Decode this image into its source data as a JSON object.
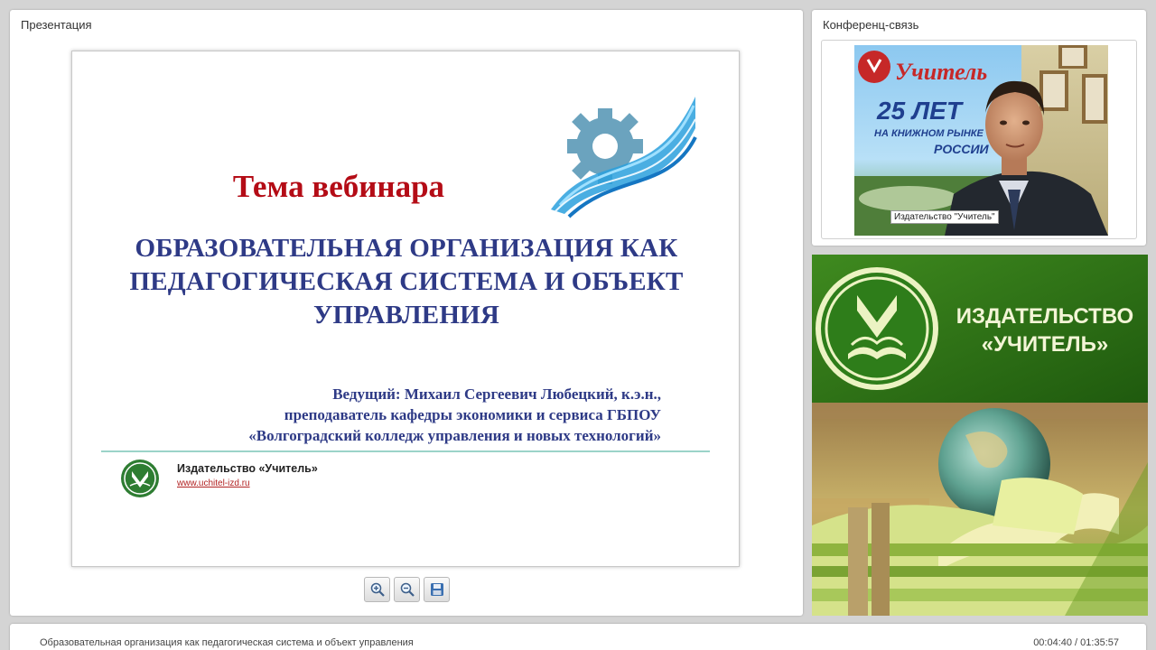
{
  "presentation_panel": {
    "title": "Презентация"
  },
  "slide": {
    "heading": "Тема вебинара",
    "subtitle_lines": [
      "ОБРАЗОВАТЕЛЬНАЯ ОРГАНИЗАЦИЯ КАК",
      "ПЕДАГОГИЧЕСКАЯ СИСТЕМА И ОБЪЕКТ",
      "УПРАВЛЕНИЯ"
    ],
    "presenter_lines": [
      "Ведущий: Михаил Сергеевич Любецкий, к.э.н.,",
      "преподаватель кафедры экономики и сервиса ГБПОУ",
      "«Волгоградский колледж управления и новых технологий»"
    ],
    "publisher": "Издательство «Учитель»",
    "url": "www.uchitel-izd.ru"
  },
  "toolbar": {
    "zoom_in_icon": "zoom-in-icon",
    "zoom_out_icon": "zoom-out-icon",
    "save_icon": "save-icon"
  },
  "conference_panel": {
    "title": "Конференц-связь",
    "caption": "Издательство \"Учитель\"",
    "backdrop": {
      "brand": "Учитель",
      "years": "25 ЛЕТ",
      "line1": "НА КНИЖНОМ РЫНКЕ",
      "line2": "РОССИИ"
    }
  },
  "banner": {
    "line1": "ИЗДАТЕЛЬСТВО",
    "line2": "«УЧИТЕЛЬ»"
  },
  "footer": {
    "title": "Образовательная организация как педагогическая система и объект управления",
    "time": "00:04:40 / 01:35:57"
  },
  "colors": {
    "slide_heading": "#b40c16",
    "slide_text": "#2e3a86",
    "banner_green": "#2e6b14"
  }
}
